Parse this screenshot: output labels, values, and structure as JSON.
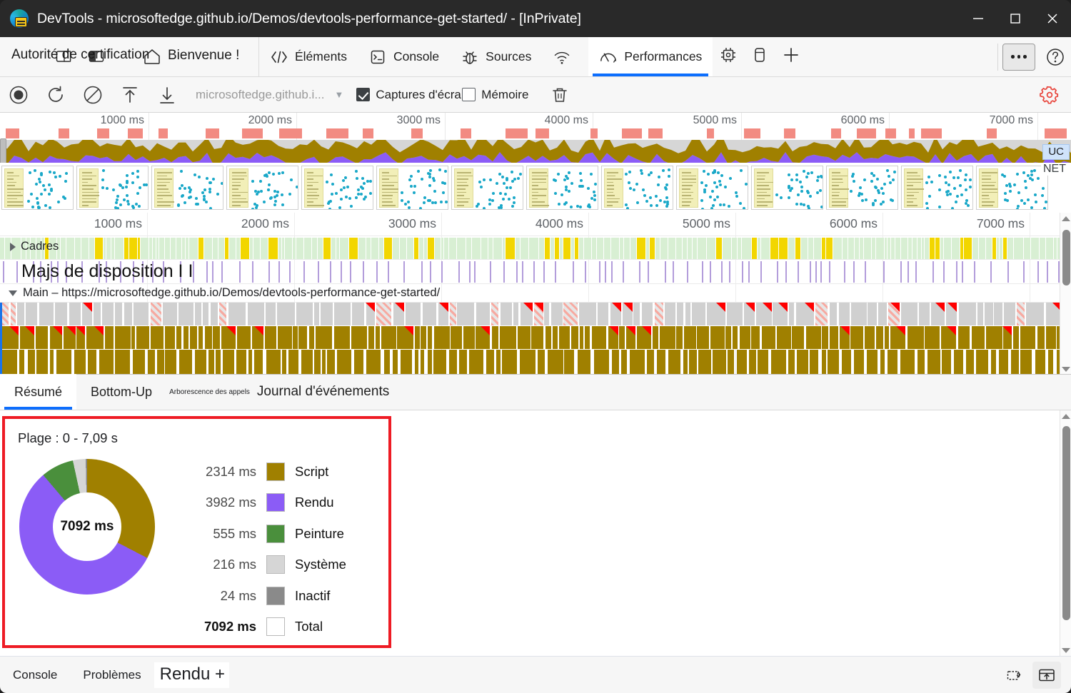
{
  "window": {
    "title": "DevTools - microsoftedge.github.io/Demos/devtools-performance-get-started/ - [InPrivate]",
    "logo_icon": "edge-devtools-logo-icon",
    "minimize_icon": "minimize-icon",
    "maximize_icon": "maximize-icon",
    "close_icon": "close-icon",
    "titlebar_bg": "#292929"
  },
  "tabstrip": {
    "overlap_label": "Autorité de certification",
    "panel_icon_1": "dock-right-icon",
    "panel_icon_2": "dock-left-icon",
    "home_icon": "home-icon",
    "home_label": "Bienvenue !",
    "tabs": [
      {
        "label": "Éléments",
        "icon": "code-brackets-icon",
        "active": false
      },
      {
        "label": "Console",
        "icon": "console-prompt-icon",
        "active": false
      },
      {
        "label": "Sources",
        "icon": "bug-icon",
        "active": false
      },
      {
        "label": "",
        "icon": "network-wifi-icon",
        "active": false
      },
      {
        "label": "Performances",
        "icon": "gauge-icon",
        "active": true
      },
      {
        "label": "",
        "icon": "memory-chip-icon",
        "active": false
      },
      {
        "label": "",
        "icon": "application-storage-icon",
        "active": false
      },
      {
        "label": "",
        "icon": "plus-icon",
        "active": false
      }
    ],
    "more_icon": "more-dots-icon",
    "help_icon": "help-question-icon",
    "accent": "#0d6efd"
  },
  "perf_toolbar": {
    "record_icon": "record-circle-icon",
    "reload_record_icon": "reload-record-icon",
    "clear_icon": "clear-no-entry-icon",
    "upload_icon": "upload-arrow-up-icon",
    "download_icon": "download-arrow-down-icon",
    "url_value": "microsoftedge.github.i...",
    "url_dropdown_icon": "chevron-down-icon",
    "screenshots_label": "Captures d'écran",
    "screenshots_checked": true,
    "memory_label": "Mémoire",
    "memory_checked": false,
    "trash_icon": "trash-icon",
    "settings_icon": "gear-icon",
    "settings_color": "#e8453c"
  },
  "overview": {
    "tick_labels": [
      "1000 ms",
      "2000 ms",
      "3000 ms",
      "4000 ms",
      "5000 ms",
      "6000 ms",
      "7000 ms"
    ],
    "cpu_tag": "UC",
    "net_tag": "NET",
    "long_task_color": "#f28b82",
    "script_color": "#a08000",
    "rendering_color": "#8b5cf6",
    "painting_color": "#4a8f3c",
    "system_color": "#d6d6d6"
  },
  "tracks": {
    "tick_labels": [
      "1000 ms",
      "2000 ms",
      "3000 ms",
      "4000 ms",
      "5000 ms",
      "6000 ms",
      "7000 ms"
    ],
    "frames_label": "Cadres",
    "frames_expander_icon": "chevron-right-icon",
    "layout_shifts_label": "Majs de disposition I I",
    "main_label": "Main – https://microsoftedge.github.io/Demos/devtools-performance-get-started/",
    "main_expander_icon": "chevron-down-icon",
    "frame_ok_color": "#d8efd3",
    "frame_partial_color": "#f2d600",
    "layout_shift_color": "#b39ddb",
    "task_color": "#d0d0d0",
    "script_color": "#a08000",
    "warning_color": "#ff0000"
  },
  "detail_tabs": [
    {
      "label": "Résumé",
      "active": true,
      "size": "normal"
    },
    {
      "label": "Bottom-Up",
      "active": false,
      "size": "normal"
    },
    {
      "label": "Arborescence des appels",
      "active": false,
      "size": "tiny"
    },
    {
      "label": "Journal d'événements",
      "active": false,
      "size": "big"
    }
  ],
  "summary": {
    "range_label": "Plage : 0 - 7,09 s",
    "highlight_color": "#ee1b24",
    "center_total": "7092 ms"
  },
  "chart_data": {
    "type": "pie",
    "title": "Plage : 0 - 7,09 s",
    "center_label": "7092 ms",
    "unit": "ms",
    "total": 7092,
    "legend_position": "right",
    "slices": [
      {
        "name": "Script",
        "value": 2314,
        "label": "2314 ms",
        "color": "#a08000"
      },
      {
        "name": "Rendu",
        "value": 3982,
        "label": "3982 ms",
        "color": "#8b5cf6"
      },
      {
        "name": "Peinture",
        "value": 555,
        "label": "555 ms",
        "color": "#4a8f3c"
      },
      {
        "name": "Système",
        "value": 216,
        "label": "216 ms",
        "color": "#d6d6d6"
      },
      {
        "name": "Inactif",
        "value": 24,
        "label": "24 ms",
        "color": "#8a8a8a"
      }
    ],
    "total_row": {
      "name": "Total",
      "value": 7092,
      "label": "7092 ms",
      "color": "#ffffff"
    }
  },
  "drawer": {
    "tabs": [
      {
        "label": "Console",
        "size": "normal"
      },
      {
        "label": "Problèmes",
        "size": "normal"
      },
      {
        "label": "Rendu +",
        "size": "large"
      }
    ],
    "restore_icon": "restore-layout-icon",
    "dock_icon": "dock-to-bottom-icon"
  }
}
